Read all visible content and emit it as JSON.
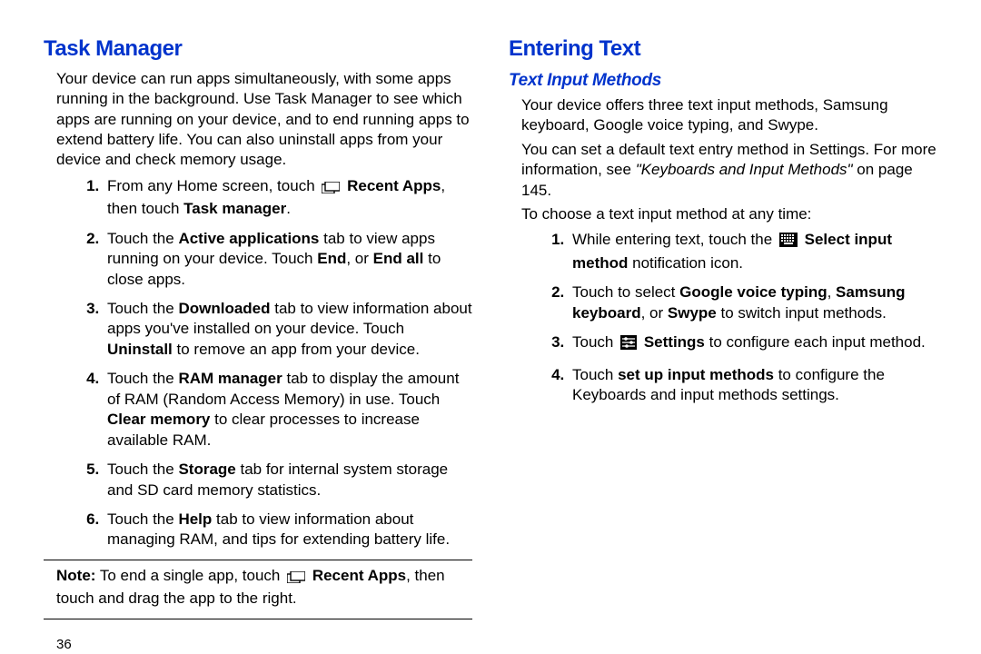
{
  "page_number": "36",
  "left": {
    "heading": "Task Manager",
    "intro": "Your device can run apps simultaneously, with some apps running in the background. Use Task Manager to see which apps are running on your device, and to end running apps to extend battery life. You can also uninstall apps from your device and check memory usage.",
    "steps": {
      "s1_a": "From any Home screen, touch ",
      "s1_b": "Recent Apps",
      "s1_c": ", then touch ",
      "s1_d": "Task manager",
      "s1_e": ".",
      "s2_a": "Touch the ",
      "s2_b": "Active applications",
      "s2_c": " tab to view apps running on your device. Touch ",
      "s2_d": "End",
      "s2_e": ", or ",
      "s2_f": "End all",
      "s2_g": " to close apps.",
      "s3_a": "Touch the ",
      "s3_b": "Downloaded",
      "s3_c": " tab to view information about apps you've installed on your device. Touch ",
      "s3_d": "Uninstall",
      "s3_e": " to remove an app from your device.",
      "s4_a": "Touch the ",
      "s4_b": "RAM manager",
      "s4_c": " tab to display the amount of RAM (Random Access Memory) in use. Touch ",
      "s4_d": "Clear memory",
      "s4_e": " to clear processes to increase available RAM.",
      "s5_a": "Touch the ",
      "s5_b": "Storage",
      "s5_c": " tab for internal system storage and SD card memory statistics.",
      "s6_a": "Touch the ",
      "s6_b": "Help",
      "s6_c": " tab to view information about managing RAM, and tips for extending battery life."
    },
    "note_label": "Note:",
    "note_a": " To end a single app, touch ",
    "note_b": "Recent Apps",
    "note_c": ", then touch and drag the app to the right."
  },
  "right": {
    "heading": "Entering Text",
    "subheading": "Text Input Methods",
    "p1": "Your device offers three text input methods, Samsung keyboard, Google voice typing, and Swype.",
    "p2_a": "You can set a default text entry method in Settings. For more information, see ",
    "p2_b": "\"Keyboards and Input Methods\"",
    "p2_c": " on page 145.",
    "p3": "To choose a text input method at any time:",
    "steps": {
      "s1_a": "While entering text, touch the ",
      "s1_b": "Select input method",
      "s1_c": " notification icon.",
      "s2_a": "Touch to select ",
      "s2_b": "Google voice typing",
      "s2_c": ", ",
      "s2_d": "Samsung keyboard",
      "s2_e": ", or ",
      "s2_f": "Swype",
      "s2_g": " to switch input methods.",
      "s3_a": "Touch ",
      "s3_b": "Settings",
      "s3_c": " to configure each input method.",
      "s4_a": "Touch ",
      "s4_b": "set up input methods",
      "s4_c": " to configure the Keyboards and input methods settings."
    }
  }
}
